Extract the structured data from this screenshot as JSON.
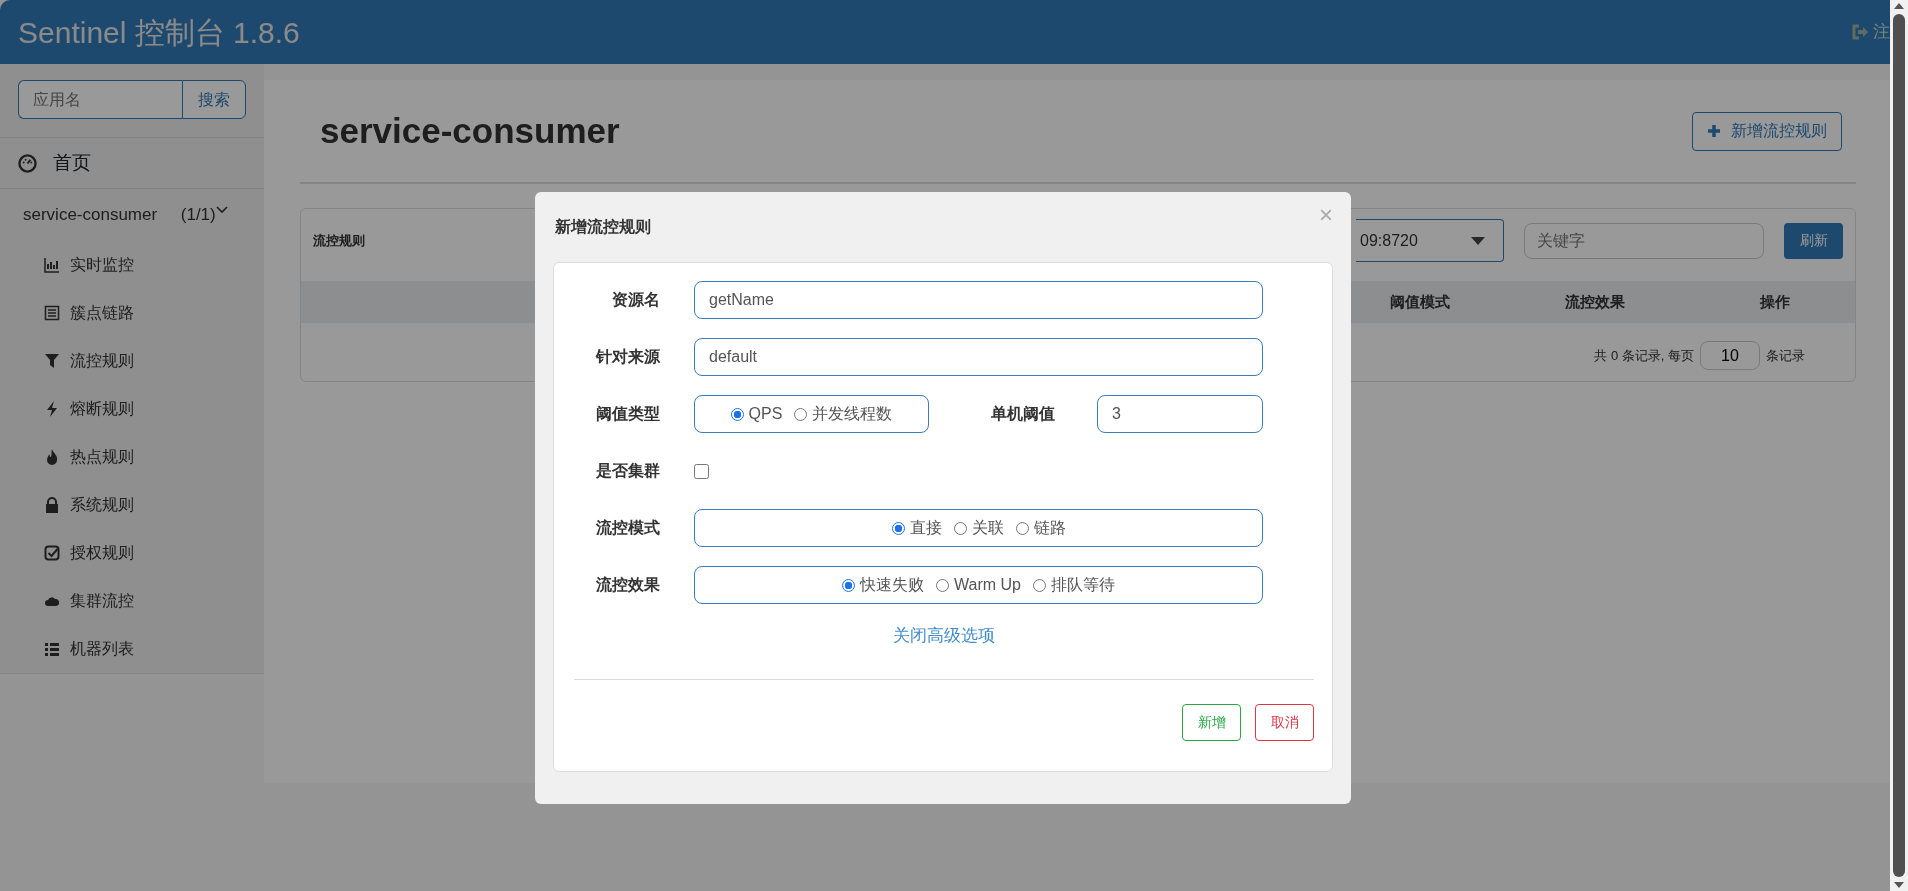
{
  "header": {
    "title": "Sentinel 控制台 1.8.6",
    "logout": "注"
  },
  "sidebar": {
    "search": {
      "placeholder": "应用名",
      "button": "搜索"
    },
    "home": "首页",
    "app": {
      "name": "service-consumer",
      "count": "(1/1)",
      "expanded": true,
      "items": [
        {
          "label": "实时监控"
        },
        {
          "label": "簇点链路"
        },
        {
          "label": "流控规则"
        },
        {
          "label": "熔断规则"
        },
        {
          "label": "热点规则"
        },
        {
          "label": "系统规则"
        },
        {
          "label": "授权规则"
        },
        {
          "label": "集群流控"
        },
        {
          "label": "机器列表"
        }
      ]
    }
  },
  "page": {
    "title": "service-consumer",
    "add_button": "新增流控规则",
    "panel": {
      "title": "流控规则",
      "machine": "09:8720",
      "keyword_placeholder": "关键字",
      "refresh": "刷新",
      "columns": [
        "阈值模式",
        "流控效果",
        "操作"
      ],
      "pagination": {
        "total_text": "共 0 条记录, 每页",
        "page_size": "10",
        "suffix": "条记录"
      }
    }
  },
  "modal": {
    "title": "新增流控规则",
    "close": "×",
    "fields": [
      {
        "kind": "text",
        "label": "资源名",
        "value": "getName"
      },
      {
        "kind": "text",
        "label": "针对来源",
        "value": "default"
      },
      {
        "kind": "radio_pair",
        "label": "阈值类型",
        "options": [
          {
            "label": "QPS",
            "selected": true
          },
          {
            "label": "并发线程数",
            "selected": false
          }
        ],
        "side_label": "单机阈值",
        "side_value": "3"
      },
      {
        "kind": "checkbox",
        "label": "是否集群",
        "checked": false
      },
      {
        "kind": "radio",
        "label": "流控模式",
        "options": [
          {
            "label": "直接",
            "selected": true
          },
          {
            "label": "关联",
            "selected": false
          },
          {
            "label": "链路",
            "selected": false
          }
        ]
      },
      {
        "kind": "radio",
        "label": "流控效果",
        "options": [
          {
            "label": "快速失败",
            "selected": true
          },
          {
            "label": "Warm Up",
            "selected": false
          },
          {
            "label": "排队等待",
            "selected": false
          }
        ]
      }
    ],
    "toggle_link": "关闭高级选项",
    "buttons": [
      {
        "kind": "confirm",
        "label": "新增"
      },
      {
        "kind": "cancel",
        "label": "取消"
      }
    ]
  }
}
